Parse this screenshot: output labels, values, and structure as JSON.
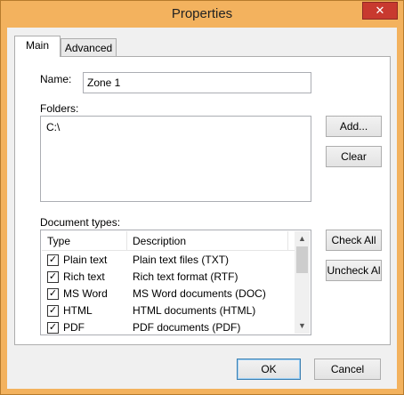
{
  "window": {
    "title": "Properties",
    "close_glyph": "✕"
  },
  "tabs": [
    {
      "label": "Main",
      "active": true
    },
    {
      "label": "Advanced",
      "active": false
    }
  ],
  "name_field": {
    "label": "Name:",
    "value": "Zone 1"
  },
  "folders": {
    "label": "Folders:",
    "items": [
      "C:\\"
    ]
  },
  "buttons": {
    "add": "Add...",
    "clear": "Clear",
    "check_all": "Check All",
    "uncheck_all": "Uncheck Al",
    "ok": "OK",
    "cancel": "Cancel"
  },
  "document_types": {
    "label": "Document types:",
    "columns": [
      "Type",
      "Description"
    ],
    "rows": [
      {
        "type": "Plain text",
        "description": "Plain text files (TXT)",
        "checked": true
      },
      {
        "type": "Rich text",
        "description": "Rich text format (RTF)",
        "checked": true
      },
      {
        "type": "MS Word",
        "description": "MS Word documents (DOC)",
        "checked": true
      },
      {
        "type": "HTML",
        "description": "HTML documents (HTML)",
        "checked": true
      },
      {
        "type": "PDF",
        "description": "PDF documents (PDF)",
        "checked": true
      }
    ],
    "scroll_position": 0.0
  },
  "colors": {
    "titlebar": "#f3b25e",
    "close": "#c8392f"
  }
}
